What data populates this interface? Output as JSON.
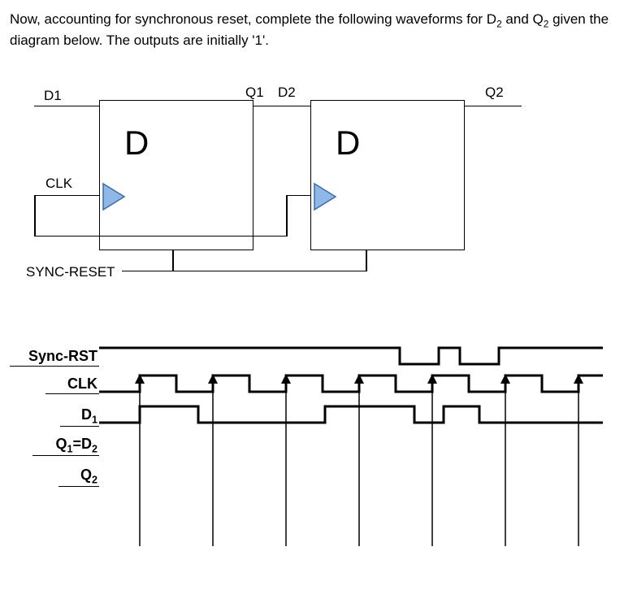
{
  "prompt": {
    "pre": "Now, accounting for synchronous reset, complete the following waveforms for D",
    "sub1": "2",
    "mid": " and Q",
    "sub2": "2",
    "post": " given the diagram below. The outputs are initially '1'."
  },
  "circuit": {
    "D1": "D1",
    "CLK": "CLK",
    "SYNC_RESET": "SYNC-RESET",
    "Q1": "Q1",
    "D2": "D2",
    "Q2": "Q2",
    "D_letter": "D"
  },
  "timing": {
    "rows": {
      "sync_rst": "Sync-RST",
      "clk": "CLK",
      "d1_pre": "D",
      "d1_sub": "1",
      "q1d2_pre": "Q",
      "q1d2_sub1": "1",
      "q1d2_mid": "=D",
      "q1d2_sub2": "2",
      "q2_pre": "Q",
      "q2_sub": "2"
    }
  },
  "chart_data": {
    "type": "waveform",
    "title": "Synchronous-reset D flip-flop chain timing diagram",
    "time_units": "arbitrary (clock periods)",
    "signals": [
      {
        "name": "Sync-RST",
        "t": [
          0,
          6.2,
          6.2,
          7.0,
          7.0,
          7.4,
          7.4,
          8.2,
          8.2,
          10
        ],
        "v": [
          1,
          1,
          0,
          0,
          1,
          1,
          0,
          0,
          1,
          1
        ],
        "note": "active-low pulses around t≈6.2-7.0 and 7.4-8.2"
      },
      {
        "name": "CLK",
        "edges_rising": [
          0.8,
          2.3,
          3.8,
          5.3,
          6.8,
          8.3,
          9.8
        ],
        "duty_cycle": 0.5,
        "period": 1.5,
        "note": "rising edges marked with arrow ticks"
      },
      {
        "name": "D1",
        "t": [
          0,
          0.8,
          0.8,
          2.0,
          2.0,
          4.6,
          4.6,
          6.5,
          6.5,
          7.1,
          7.1,
          7.8,
          7.8,
          10
        ],
        "v": [
          0,
          0,
          1,
          1,
          0,
          0,
          1,
          1,
          0,
          0,
          1,
          1,
          0,
          0
        ]
      },
      {
        "name": "Q1=D2",
        "v_initial": 1,
        "note": "blank row to be completed by student"
      },
      {
        "name": "Q2",
        "v_initial": 1,
        "note": "blank row to be completed by student"
      }
    ],
    "vertical_guides_x": [
      0.8,
      2.3,
      3.8,
      5.3,
      6.8,
      8.3,
      9.8
    ]
  }
}
